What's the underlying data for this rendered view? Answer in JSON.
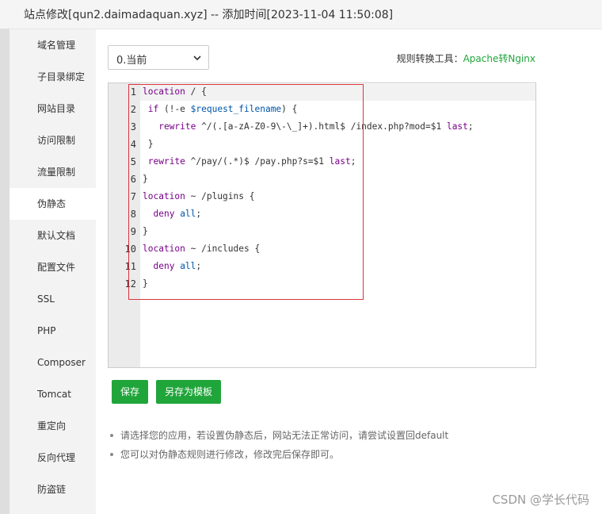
{
  "window": {
    "title": "站点修改[qun2.daimadaquan.xyz] -- 添加时间[2023-11-04 11:50:08]"
  },
  "sidebar": {
    "items": [
      {
        "label": "域名管理"
      },
      {
        "label": "子目录绑定"
      },
      {
        "label": "网站目录"
      },
      {
        "label": "访问限制"
      },
      {
        "label": "流量限制"
      },
      {
        "label": "伪静态",
        "active": true
      },
      {
        "label": "默认文档"
      },
      {
        "label": "配置文件"
      },
      {
        "label": "SSL"
      },
      {
        "label": "PHP"
      },
      {
        "label": "Composer"
      },
      {
        "label": "Tomcat"
      },
      {
        "label": "重定向"
      },
      {
        "label": "反向代理"
      },
      {
        "label": "防盗链"
      }
    ]
  },
  "toolbar": {
    "select_value": "0.当前",
    "tools_label": "规则转换工具：",
    "tools_link": "Apache转Nginx"
  },
  "editor": {
    "line_numbers": [
      "1",
      "2",
      "3",
      "4",
      "5",
      "6",
      "7",
      "8",
      "9",
      "10",
      "11",
      "12"
    ],
    "lines": [
      "location / {",
      " if (!-e $request_filename) {",
      "   rewrite ^/(.[a-zA-Z0-9\\-\\_]+).html$ /index.php?mod=$1 last;",
      " }",
      " rewrite ^/pay/(.*)$ /pay.php?s=$1 last;",
      "}",
      "location ~ /plugins {",
      "  deny all;",
      "}",
      "location ~ /includes {",
      "  deny all;",
      "}"
    ]
  },
  "buttons": {
    "save": "保存",
    "save_template": "另存为模板"
  },
  "tips": [
    "请选择您的应用，若设置伪静态后，网站无法正常访问，请尝试设置回default",
    "您可以对伪静态规则进行修改，修改完后保存即可。"
  ],
  "watermark": "CSDN @学长代码",
  "colors": {
    "accent": "#20a53a",
    "highlight_box": "#d9363e"
  }
}
